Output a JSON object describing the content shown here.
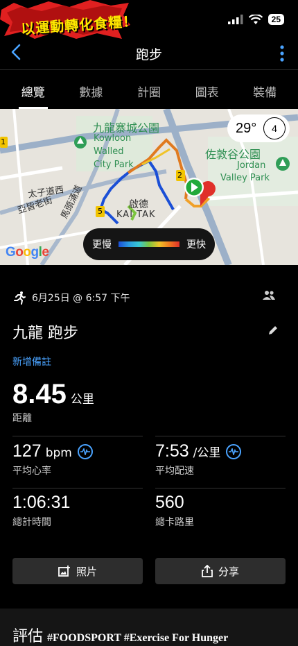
{
  "status_bar": {
    "banner_text": "以運動轉化食糧！",
    "battery": "25"
  },
  "nav": {
    "title": "跑步"
  },
  "tabs": [
    {
      "label": "總覽",
      "active": true
    },
    {
      "label": "數據",
      "active": false
    },
    {
      "label": "計圈",
      "active": false
    },
    {
      "label": "圖表",
      "active": false
    },
    {
      "label": "裝備",
      "active": false
    }
  ],
  "map": {
    "labels": {
      "kowloon_cn": "九龍寨城公園",
      "kowloon_en1": "Kowloon",
      "kowloon_en2": "Walled",
      "kowloon_en3": "City Park",
      "jordan_cn": "佐敦谷公園",
      "jordan_en1": "Jordan",
      "jordan_en2": "Valley Park",
      "prince_rd": "太子道西",
      "argyle": "亞皆老街",
      "matauchung": "馬頭涌道",
      "kaitak_cn": "啟德",
      "kaitak_en": "KAI TAK"
    },
    "markers": {
      "m1": "1",
      "m2": "2",
      "m5": "5"
    },
    "weather": {
      "temp": "29°",
      "wind": "4"
    },
    "legend": {
      "slower": "更慢",
      "faster": "更快"
    },
    "attribution": "Google",
    "colors": {
      "route_slow": "#1b4fd6",
      "route_mid": "#7cc43f",
      "route_fast": "#e07a20",
      "start": "#22a93a",
      "end": "#e0302a"
    }
  },
  "activity": {
    "datetime": "6月25日 @ 6:57 下午",
    "title": "九龍 跑步",
    "add_note": "新增備註",
    "distance": {
      "value": "8.45",
      "unit": "公里",
      "label": "距離"
    },
    "heart_rate": {
      "value": "127",
      "unit": "bpm",
      "label": "平均心率"
    },
    "pace": {
      "value": "7:53",
      "unit": "/公里",
      "label": "平均配速"
    },
    "total_time": {
      "value": "1:06:31",
      "label": "總計時間"
    },
    "calories": {
      "value": "560",
      "label": "總卡路里"
    }
  },
  "buttons": {
    "photos": "照片",
    "share": "分享"
  },
  "evaluation": {
    "title": "評估",
    "watermark": "#FOODSPORT #Exercise For Hunger"
  }
}
